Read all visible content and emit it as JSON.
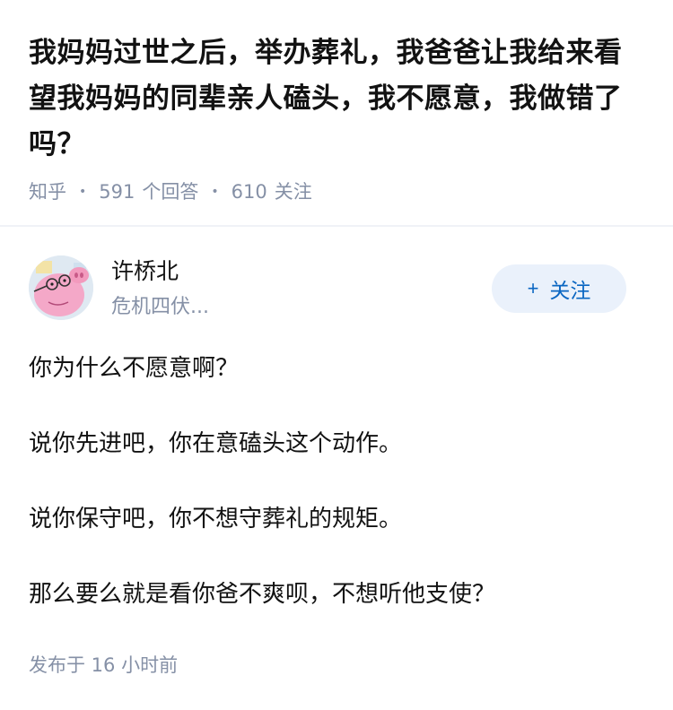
{
  "question": {
    "title": "我妈妈过世之后，举办葬礼，我爸爸让我给来看望我妈妈的同辈亲人磕头，我不愿意，我做错了吗？",
    "source": "知乎",
    "answers_count": "591",
    "answers_label": "个回答",
    "followers_count": "610",
    "followers_label": "关注"
  },
  "author": {
    "name": "许桥北",
    "bio": "危机四伏...",
    "avatar_icon": "pig-avatar-icon",
    "follow_label": "关注",
    "follow_icon": "plus-icon"
  },
  "answer": {
    "paragraphs": [
      "你为什么不愿意啊？",
      "说你先进吧，你在意磕头这个动作。",
      "说你保守吧，你不想守葬礼的规矩。",
      "那么要么就是看你爸不爽呗，不想听他支使？"
    ]
  },
  "published": "发布于 16 小时前",
  "colors": {
    "meta_gray": "#8590a6",
    "follow_blue": "#0a66c2",
    "follow_bg": "#eaf1fb"
  }
}
